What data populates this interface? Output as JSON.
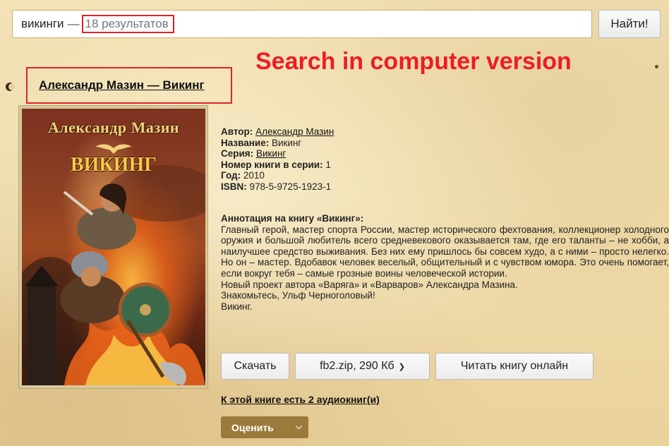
{
  "search": {
    "query": "викинги",
    "dash": "—",
    "result_count": "18 результатов",
    "button_label": "Найти!"
  },
  "banner": "Search in computer version",
  "book": {
    "title_link": "Александр Мазин — Викинг",
    "cover": {
      "author": "Александр Мазин",
      "title": "ВИКИНГ"
    },
    "meta": {
      "author_label": "Автор:",
      "author": "Александр Мазин",
      "name_label": "Название:",
      "name": "Викинг",
      "series_label": "Серия:",
      "series": "Викинг",
      "series_number_label": "Номер книги в серии:",
      "series_number": "1",
      "year_label": "Год:",
      "year": "2010",
      "isbn_label": "ISBN:",
      "isbn": "978-5-9725-1923-1"
    },
    "annotation": {
      "heading": "Аннотация на книгу «Викинг»:",
      "paragraph": "Главный герой, мастер спорта России, мастер исторического фехтования, коллекционер холодного оружия и большой любитель всего средневекового оказывается там, где его таланты – не хобби, а наилучшее средство выживания. Без них ему пришлось бы совсем худо, а с ними – просто нелегко. Но он – мастер. Вдобавок человек веселый, общительный и с чувством юмора. Это очень помогает, если вокруг тебя – самые грозные воины человеческой истории.",
      "line2": "Новый проект автора «Варяга» и «Варваров» Александра Мазина.",
      "line3": "Знакомьтесь, Ульф Черноголовый!",
      "line4": "Викинг."
    }
  },
  "actions": {
    "download": "Скачать",
    "format": "fb2.zip, 290 Кб",
    "read_online": "Читать книгу онлайн",
    "audiobooks": "К этой книге есть 2 аудиокниг(и)",
    "rate": "Оценить"
  },
  "colors": {
    "highlight_red": "#ee1c24",
    "rate_button": "#9c7a3c"
  }
}
